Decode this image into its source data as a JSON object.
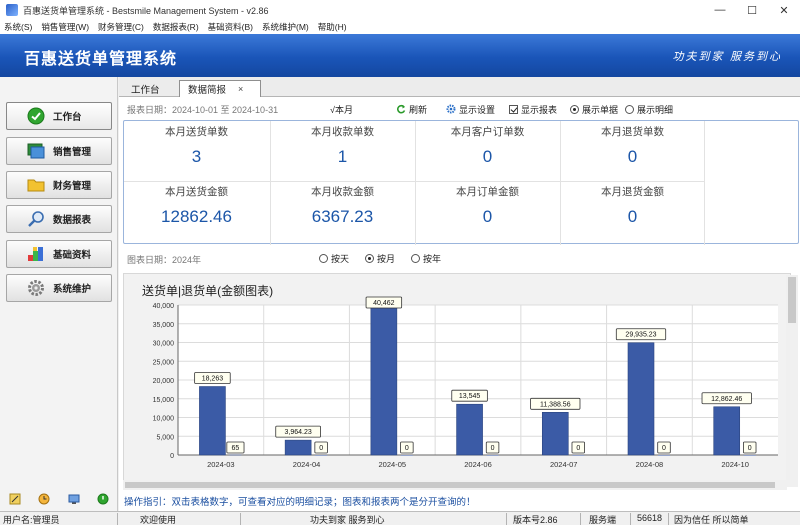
{
  "window": {
    "title": "百惠送货单管理系统 - Bestsmile Management System - v2.86",
    "controls": {
      "minimize": "—",
      "maximize": "☐",
      "close": "✕"
    }
  },
  "menu": [
    "系统(S)",
    "销售管理(W)",
    "财务管理(C)",
    "数据报表(R)",
    "基础资料(B)",
    "系统维护(M)",
    "帮助(H)"
  ],
  "banner": {
    "title": "百惠送货单管理系统",
    "slogan": "功夫到家 服务到心"
  },
  "sidebar": {
    "items": [
      {
        "label": "工作台",
        "icon": "check-circle-icon"
      },
      {
        "label": "销售管理",
        "icon": "window-icon"
      },
      {
        "label": "财务管理",
        "icon": "folder-icon"
      },
      {
        "label": "数据报表",
        "icon": "magnifier-icon"
      },
      {
        "label": "基础资料",
        "icon": "blocks-icon"
      },
      {
        "label": "系统维护",
        "icon": "gear-icon"
      }
    ]
  },
  "tabs": [
    {
      "label": "工作台"
    },
    {
      "label": "数据简报",
      "close": "×"
    }
  ],
  "toolbar": {
    "report_date": "报表日期：2024-10-01 至 2024-10-31",
    "this_month": "√本月",
    "refresh": "刷新",
    "display_settings": "显示设置",
    "show_report": "显示报表",
    "show_orders": "展示单据",
    "show_details": "展示明细"
  },
  "stats": [
    {
      "label": "本月送货单数",
      "value": "3"
    },
    {
      "label": "本月收款单数",
      "value": "1"
    },
    {
      "label": "本月客户订单数",
      "value": "0"
    },
    {
      "label": "本月退货单数",
      "value": "0"
    },
    {
      "label": "本月送货金额",
      "value": "12862.46"
    },
    {
      "label": "本月收款金额",
      "value": "6367.23"
    },
    {
      "label": "本月订单金额",
      "value": "0"
    },
    {
      "label": "本月退货金额",
      "value": "0"
    }
  ],
  "chart_filter": {
    "chart_date": "图表日期：2024年",
    "by_day": "按天",
    "by_month": "按月",
    "by_year": "按年"
  },
  "chart_data": {
    "type": "bar",
    "title": "送货单|退货单(金额图表)",
    "categories": [
      "2024-03",
      "2024-04",
      "2024-05",
      "2024-06",
      "2024-07",
      "2024-08",
      "2024-10"
    ],
    "series": [
      {
        "values": [
          18263,
          3964.23,
          40462,
          13545,
          11388.56,
          29935.23,
          12862.46
        ],
        "labels": [
          "18,263",
          "3,964.23",
          "40,462",
          "13,545",
          "11,388.56",
          "29,935.23",
          "12,862.46"
        ],
        "color": "#3b5ba6"
      },
      {
        "values": [
          65,
          0,
          0,
          0,
          0,
          0,
          0
        ],
        "labels": [
          "65",
          "0",
          "0",
          "0",
          "0",
          "0",
          "0"
        ],
        "color": "#3b5ba6"
      }
    ],
    "ylim": [
      0,
      40000
    ],
    "yticks": [
      0,
      5000,
      10000,
      15000,
      20000,
      25000,
      30000,
      35000,
      40000
    ],
    "ytick_labels": [
      "0",
      "5,000",
      "10,000",
      "15,000",
      "20,000",
      "25,000",
      "30,000",
      "35,000",
      "40,000"
    ],
    "grid": true
  },
  "hint": "操作指引：双击表格数字，可查看对应的明细记录；图表和报表两个是分开查询的！",
  "statusbar": {
    "user": "用户名:管理员",
    "welcome": "欢迎使用",
    "slogan": "功夫到家 服务到心",
    "version": "版本号2.86",
    "service_label": "服务端",
    "service_code": "56618",
    "motto": "因为信任 所以简单"
  }
}
